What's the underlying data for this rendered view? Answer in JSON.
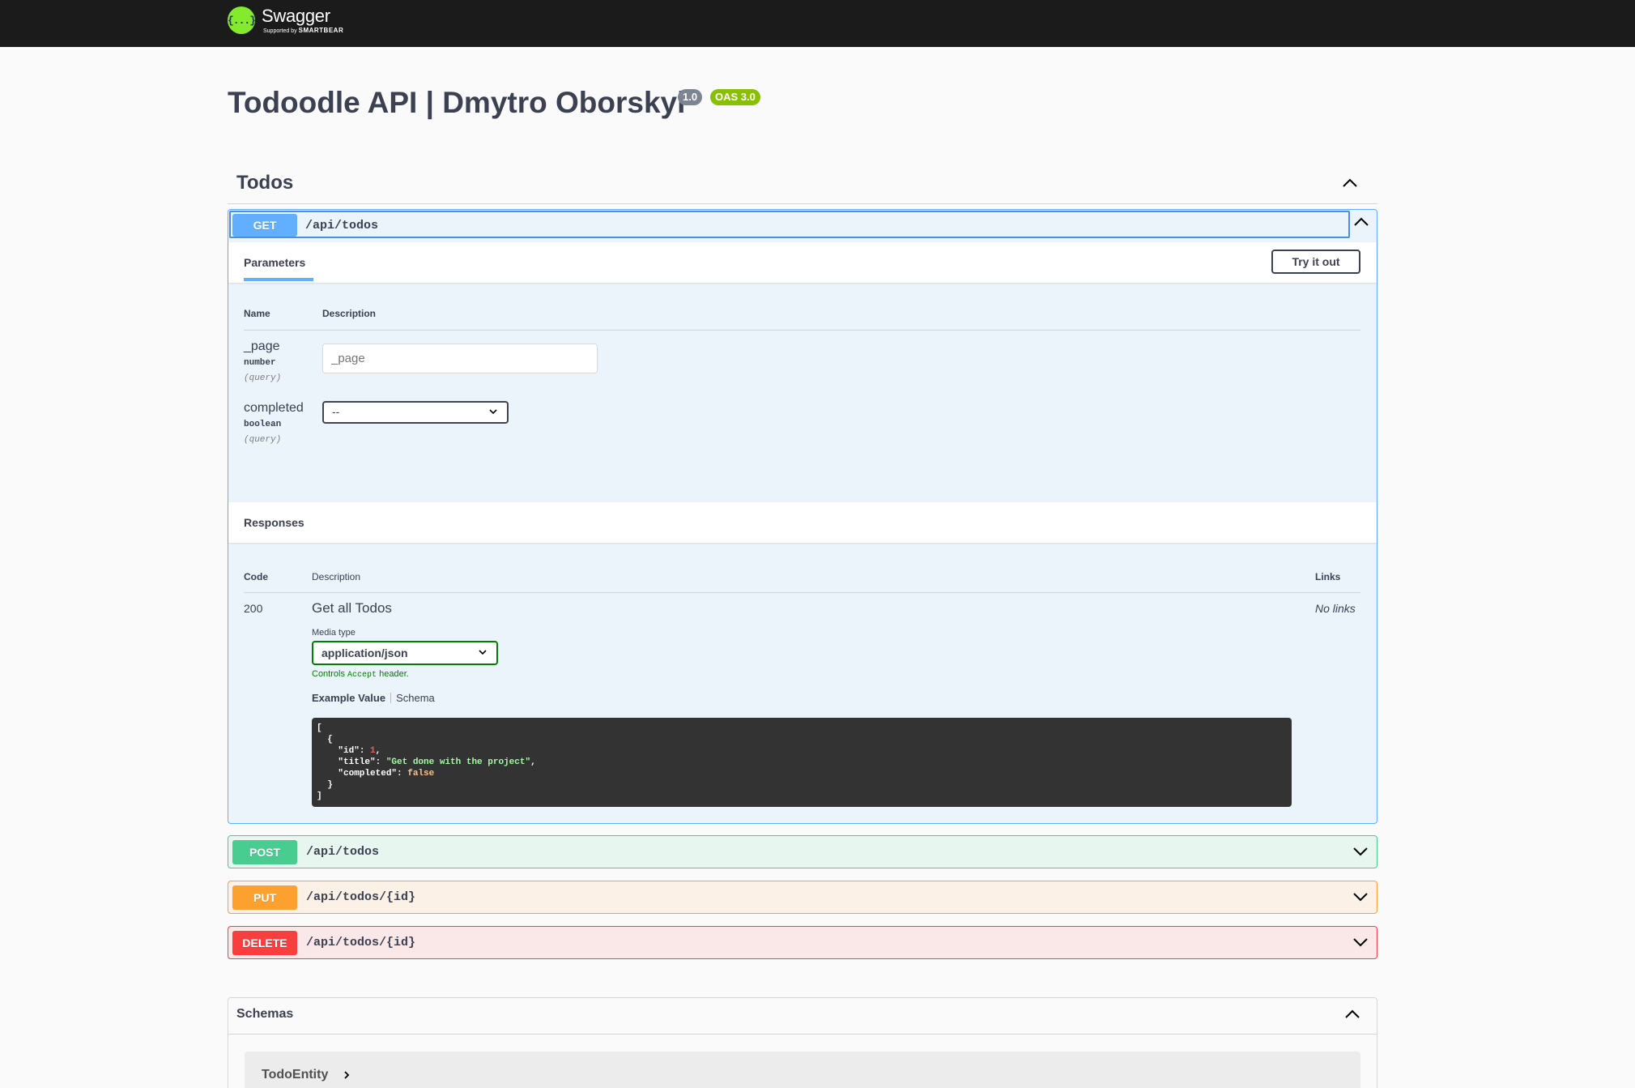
{
  "header": {
    "logo_icon": "swagger-braces-icon",
    "logo_glyph": "{...}",
    "brand": "Swagger",
    "supported_by": "Supported by",
    "smartbear": "SMARTBEAR"
  },
  "info": {
    "title": "Todoodle API | Dmytro Oborskyi",
    "version": "1.0",
    "oas": "OAS 3.0"
  },
  "tag": {
    "name": "Todos"
  },
  "operations": [
    {
      "method": "GET",
      "path": "/api/todos",
      "color": "#61affe"
    },
    {
      "method": "POST",
      "path": "/api/todos",
      "color": "#49cc90"
    },
    {
      "method": "PUT",
      "path": "/api/todos/{id}",
      "color": "#fca130"
    },
    {
      "method": "DELETE",
      "path": "/api/todos/{id}",
      "color": "#f93e3e"
    }
  ],
  "get_details": {
    "parameters_tab": "Parameters",
    "try_it_out": "Try it out",
    "col_name": "Name",
    "col_description": "Description",
    "params": [
      {
        "name": "_page",
        "type": "number",
        "in": "(query)",
        "placeholder": "_page"
      },
      {
        "name": "completed",
        "type": "boolean",
        "in": "(query)",
        "selected": "--"
      }
    ],
    "responses_title": "Responses",
    "col_code": "Code",
    "col_resp_description": "Description",
    "col_links": "Links",
    "response": {
      "code": "200",
      "description": "Get all Todos",
      "links": "No links",
      "media_type_label": "Media type",
      "media_type": "application/json",
      "controls_prefix": "Controls",
      "controls_code": "Accept",
      "controls_suffix": "header.",
      "example_value_tab": "Example Value",
      "schema_tab": "Schema",
      "example": {
        "id_key": "\"id\"",
        "id_val": "1",
        "title_key": "\"title\"",
        "title_val": "\"Get done with the project\"",
        "completed_key": "\"completed\"",
        "completed_val": "false"
      }
    }
  },
  "schemas": {
    "title": "Schemas",
    "models": [
      "TodoEntity"
    ]
  },
  "colors": {
    "topbar": "#1b1b1b",
    "logo_green": "#85ea2d",
    "version_badge": "#7d8492",
    "oas_badge": "#89bf04"
  }
}
